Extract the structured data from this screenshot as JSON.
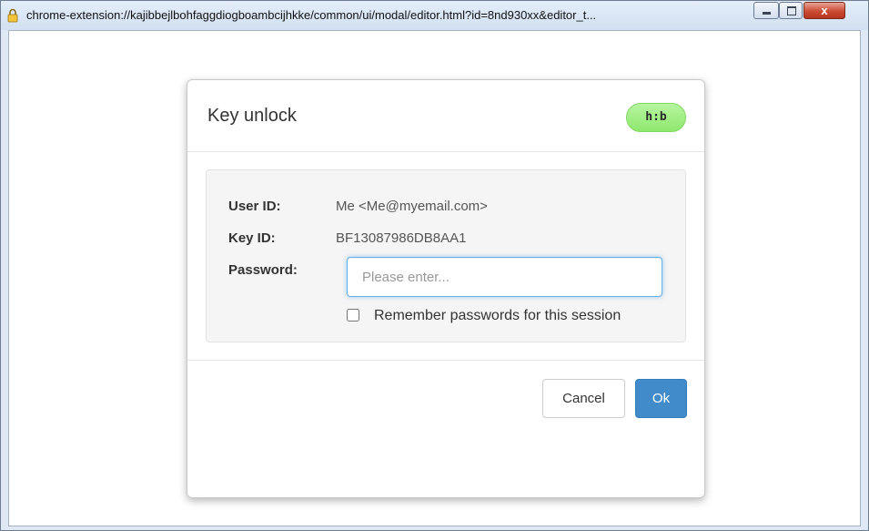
{
  "window": {
    "title": "chrome-extension://kajibbejlbohfaggdiogboambcijhkke/common/ui/modal/editor.html?id=8nd930xx&editor_t...",
    "close_glyph": "x"
  },
  "modal": {
    "title": "Key unlock",
    "security_badge": "h:b",
    "fields": {
      "user_id_label": "User ID:",
      "user_id_value": "Me <Me@myemail.com>",
      "key_id_label": "Key ID:",
      "key_id_value": "BF13087986DB8AA1",
      "password_label": "Password:",
      "password_placeholder": "Please enter...",
      "password_value": ""
    },
    "remember": {
      "label": "Remember passwords for this session",
      "checked": false
    },
    "buttons": {
      "cancel_label": "Cancel",
      "ok_label": "Ok"
    }
  },
  "colors": {
    "primary": "#428bca",
    "badge": "#8fe86e",
    "focus": "#66afe9"
  }
}
